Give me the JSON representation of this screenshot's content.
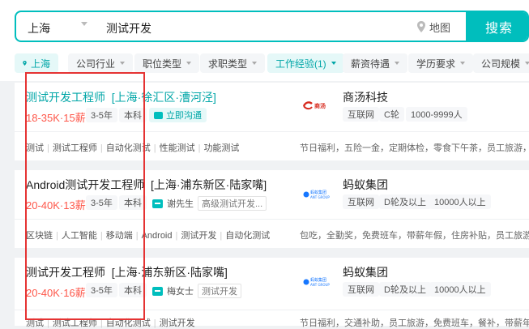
{
  "search": {
    "city": "上海",
    "query": "测试开发",
    "map_label": "地图",
    "button_label": "搜索"
  },
  "filters": {
    "location": "上海",
    "items": [
      "公司行业",
      "职位类型",
      "求职类型",
      "工作经验(1)",
      "薪资待遇",
      "学历要求",
      "公司规模"
    ]
  },
  "jobs": [
    {
      "title": "测试开发工程师",
      "location": "[上海·徐汇区·漕河泾]",
      "salary": "18-35K·15薪",
      "experience": "3-5年",
      "education": "本科",
      "chat_label": "立即沟通",
      "skills": [
        "测试",
        "测试工程师",
        "自动化测试",
        "性能测试",
        "功能测试"
      ],
      "company": {
        "name": "商汤科技",
        "logo_text": "商汤",
        "industry": "互联网",
        "stage": "C轮",
        "size": "1000-9999人"
      },
      "welfare": "节日福利，五险一金，定期体检，零食下午茶，员工旅游，..."
    },
    {
      "title": "Android测试开发工程师",
      "location": "[上海·浦东新区·陆家嘴]",
      "salary": "20-40K·13薪",
      "experience": "3-5年",
      "education": "本科",
      "recruiter": "谢先生",
      "recruiter_title": "高级测试开发...",
      "skills": [
        "区块链",
        "人工智能",
        "移动端",
        "Android",
        "测试开发",
        "自动化测试"
      ],
      "company": {
        "name": "蚂蚁集团",
        "logo_text": "蚂蚁集团 ANT GROUP",
        "industry": "互联网",
        "stage": "D轮及以上",
        "size": "10000人以上"
      },
      "welfare": "包吃，全勤奖，免费班车，带薪年假，住房补贴，员工旅游..."
    },
    {
      "title": "测试开发工程师",
      "location": "[上海·浦东新区·陆家嘴]",
      "salary": "20-40K·16薪",
      "experience": "3-5年",
      "education": "本科",
      "recruiter": "梅女士",
      "recruiter_title": "测试开发",
      "skills": [
        "测试",
        "测试工程师",
        "自动化测试",
        "测试开发"
      ],
      "company": {
        "name": "蚂蚁集团",
        "logo_text": "蚂蚁集团 ANT GROUP",
        "industry": "互联网",
        "stage": "D轮及以上",
        "size": "10000人以上"
      },
      "welfare": "节日福利，交通补助，员工旅游，免费班车，餐补，带薪年..."
    }
  ],
  "colors": {
    "accent": "#00bebd",
    "salary": "#fe574a",
    "highlight_box": "#e53333"
  }
}
